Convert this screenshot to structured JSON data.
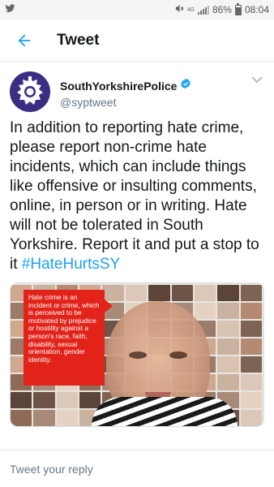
{
  "status_bar": {
    "battery_percent": "86%",
    "time": "08:04",
    "network_label": "4G"
  },
  "app_bar": {
    "title": "Tweet",
    "back_icon": "arrow-left-icon"
  },
  "tweet": {
    "author": {
      "display_name": "SouthYorkshirePolice",
      "handle": "@syptweet",
      "verified": true
    },
    "text": "In addition to reporting hate crime, please report non-crime hate incidents, which can include things like offensive or insulting comments, online, in person or in writing. Hate will not be tolerated in South Yorkshire. Report it and put a stop to it ",
    "hashtag": "#HateHurtsSY",
    "media": {
      "caption_box_text": "Hate crime is an incident or crime, which is perceived to be motivated by prejudice or hostility against a person's race, faith, disability, sexual orientation, gender identity."
    }
  },
  "reply": {
    "placeholder": "Tweet your reply"
  },
  "colors": {
    "accent": "#1da1f2",
    "avatar_bg": "#3b2d82",
    "poster_red": "#e2231a"
  }
}
